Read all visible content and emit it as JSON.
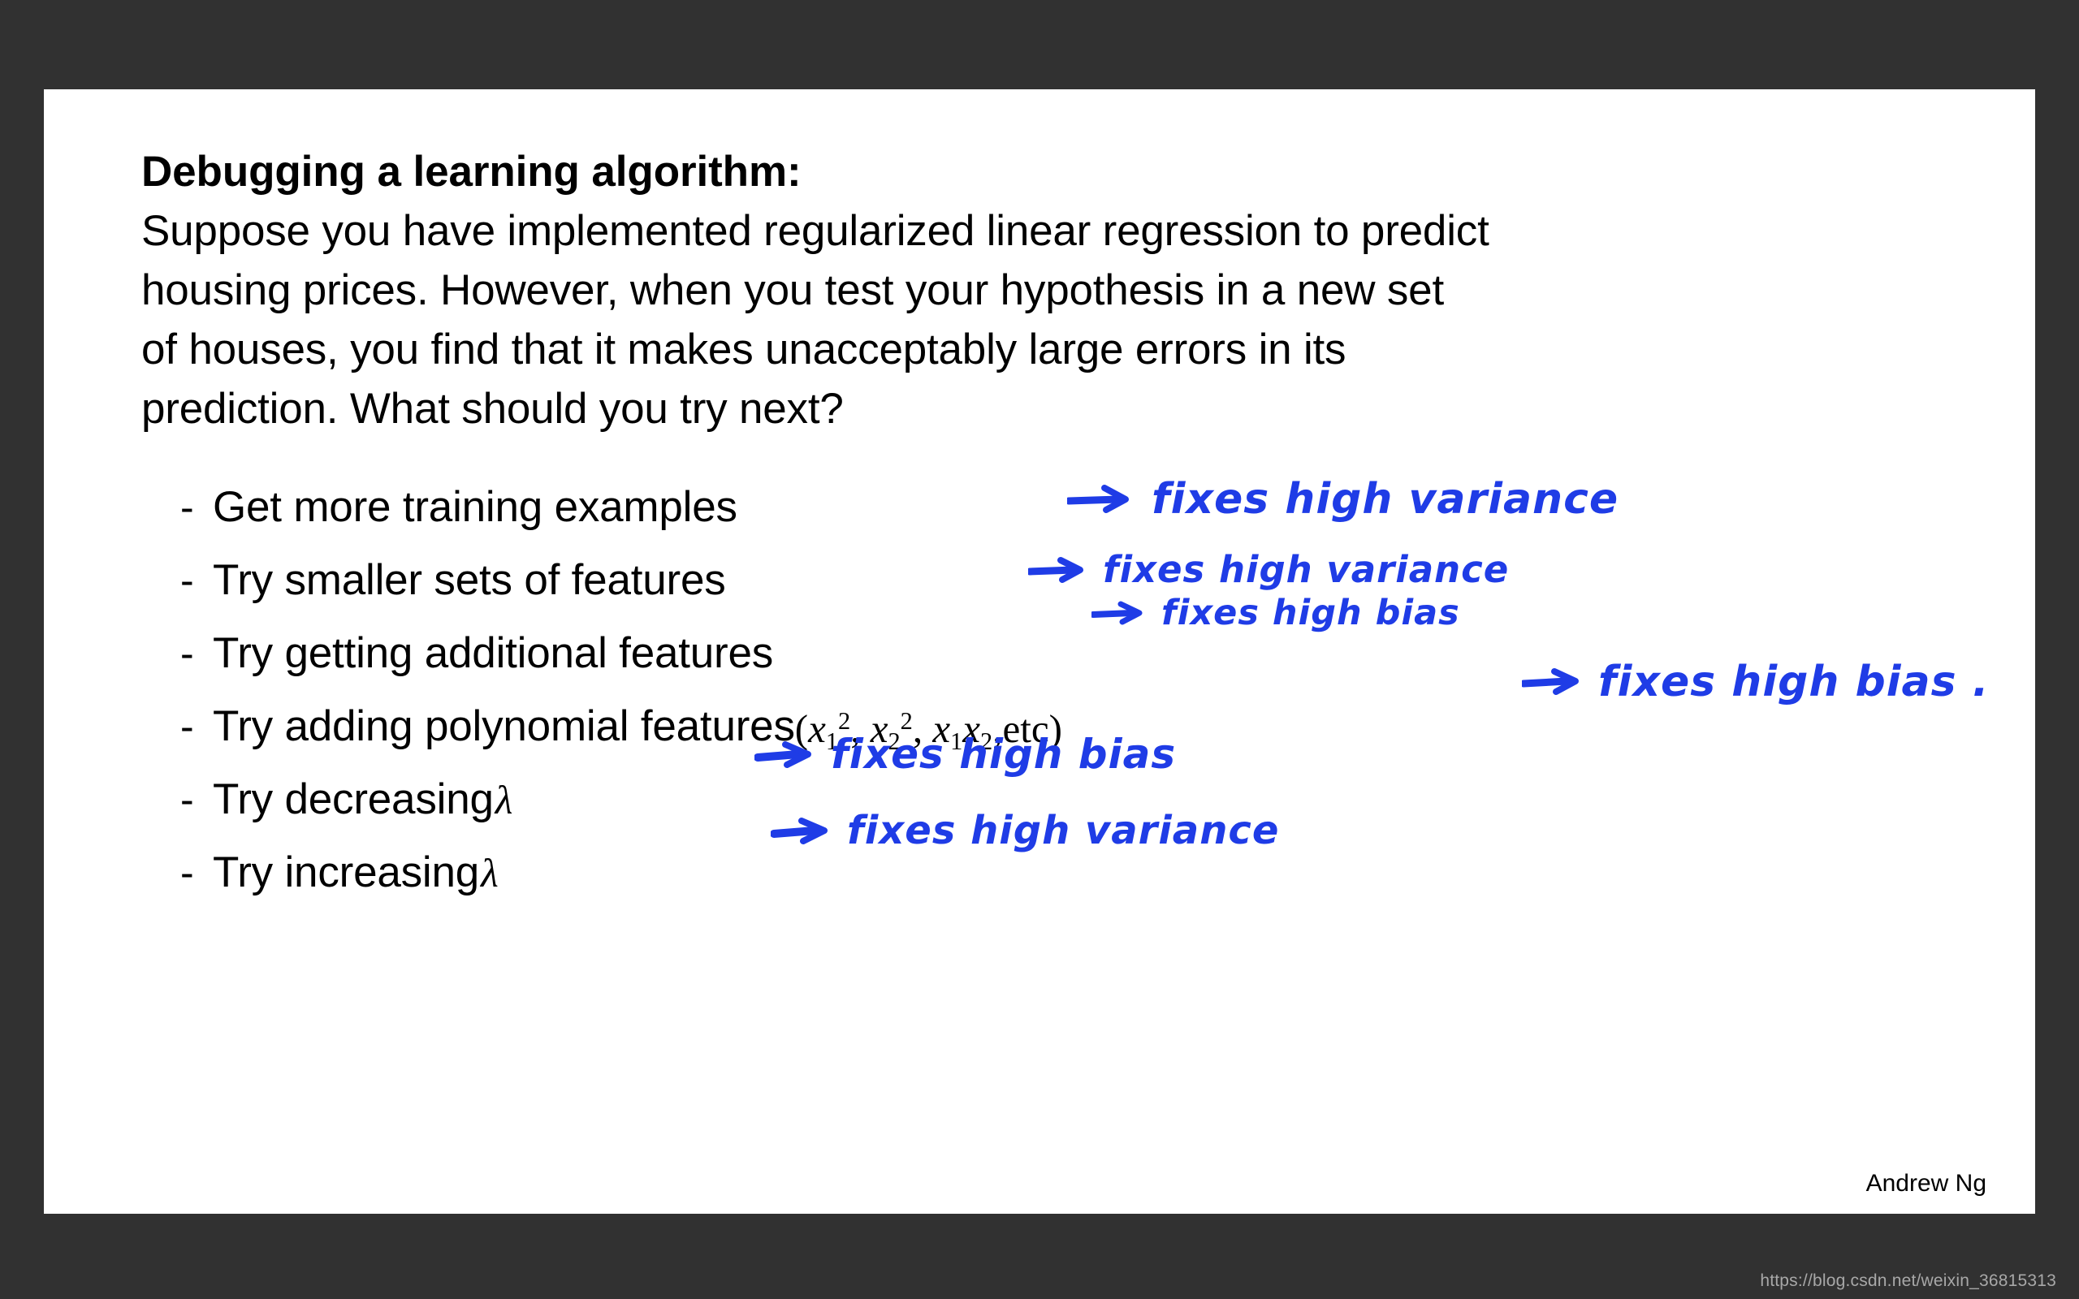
{
  "slide": {
    "background_color": "#313131",
    "canvas_color": "#ffffff",
    "ink_color": "#1f3ce6"
  },
  "prompt": {
    "title": "Debugging a learning algorithm:",
    "line1": "Suppose you have implemented regularized linear regression to predict",
    "line2": "housing prices. However, when you test your hypothesis in a new set",
    "line3": "of houses, you find that it makes unacceptably large errors in its",
    "line4": "prediction. What should you try next?"
  },
  "bullets": [
    {
      "marker": "-",
      "text": "Get more training examples",
      "annotation": "fixes  high  variance",
      "arrow": "arrow-right"
    },
    {
      "marker": "-",
      "text": "Try smaller sets of features",
      "annotation": "fixes  high  variance",
      "arrow": "arrow-right"
    },
    {
      "marker": "-",
      "text": "Try getting additional features",
      "annotation": "fixes  high  bias",
      "arrow": "arrow-right"
    },
    {
      "marker": "-",
      "text": "Try adding polynomial features",
      "math": "(x₁², x₂², x₁x₂, etc)",
      "annotation": "fixes  high  bias .",
      "arrow": "arrow-right"
    },
    {
      "marker": "-",
      "text": "Try decreasing",
      "symbol": "λ",
      "annotation": "fixes  high  bias",
      "arrow": "arrow-right"
    },
    {
      "marker": "-",
      "text": "Try increasing",
      "symbol": "λ",
      "annotation": "fixes  high  variance",
      "arrow": "arrow-right"
    }
  ],
  "footer": {
    "author": "Andrew Ng"
  },
  "watermark": {
    "url": "https://blog.csdn.net/weixin_36815313"
  }
}
